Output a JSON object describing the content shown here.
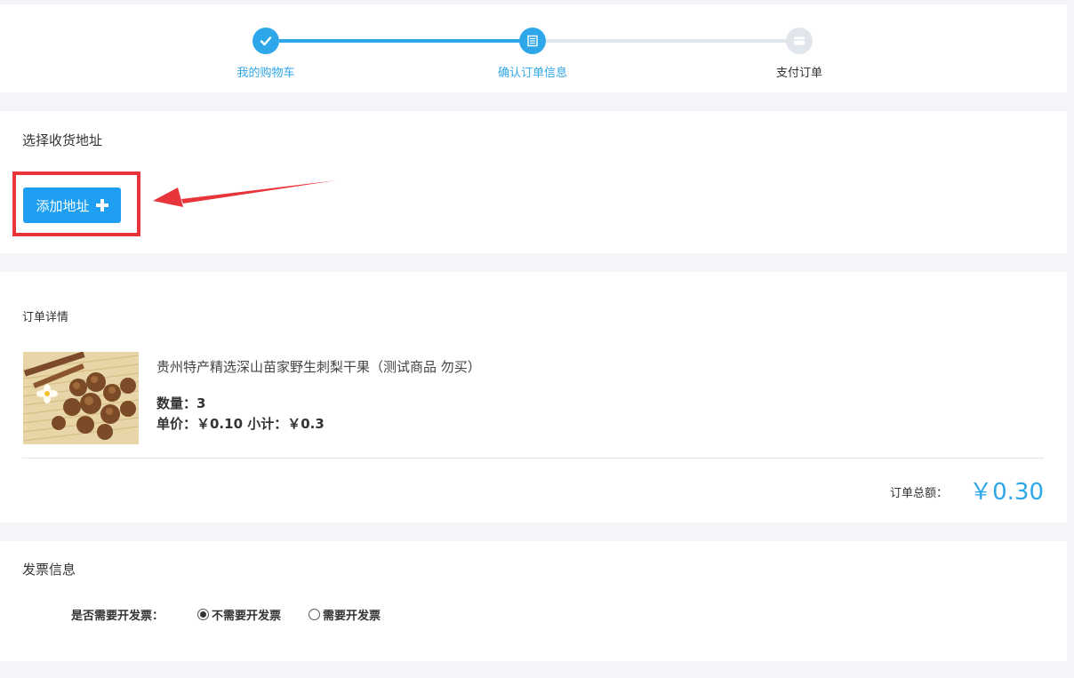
{
  "steps": [
    {
      "label": "我的购物车",
      "state": "done",
      "icon": "check-icon"
    },
    {
      "label": "确认订单信息",
      "state": "active",
      "icon": "list-icon"
    },
    {
      "label": "支付订单",
      "state": "pending",
      "icon": "card-icon"
    }
  ],
  "colors": {
    "accent": "#2ea7ea",
    "button": "#1e9ff2",
    "step_pending": "#e1e5ec",
    "highlight": "#e8343b",
    "page_bg": "#f3f5f8"
  },
  "address": {
    "title": "选择收货地址",
    "add_button_label": "添加地址",
    "add_button_icon": "plus-icon"
  },
  "order": {
    "title": "订单详情",
    "product": {
      "name": "贵州特产精选深山苗家野生刺梨干果（测试商品 勿买）",
      "quantity_text": "数量：3",
      "price_text": "单价：￥0.10 小计：￥0.3"
    },
    "total_label": "订单总额：",
    "total_value": "￥0.30"
  },
  "invoice": {
    "title": "发票信息",
    "question": "是否需要开发票：",
    "options": [
      {
        "label": "不需要开发票",
        "selected": true
      },
      {
        "label": "需要开发票",
        "selected": false
      }
    ]
  }
}
